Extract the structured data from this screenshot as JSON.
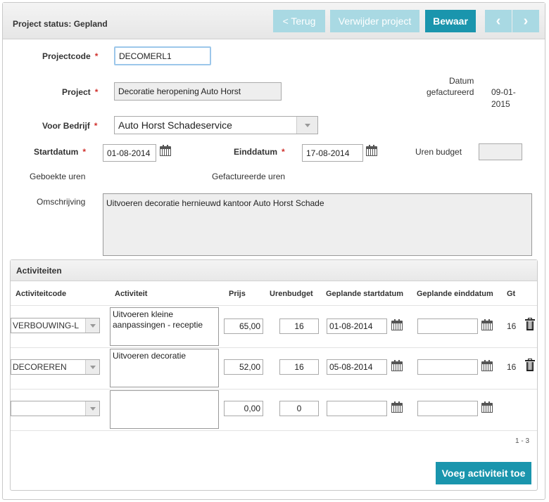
{
  "header": {
    "title": "Project status: Gepland",
    "back_label": "< Terug",
    "delete_label": "Verwijder project",
    "save_label": "Bewaar",
    "prev_label": "‹",
    "next_label": "›"
  },
  "form": {
    "projectcode_label": "Projectcode",
    "projectcode_value": "DECOMERL1",
    "project_label": "Project",
    "project_value": "Decoratie heropening Auto Horst",
    "datum_label_1": "Datum",
    "datum_label_2": "gefactureerd",
    "datum_value_1": "09-01-",
    "datum_value_2": "2015",
    "bedrijf_label": "Voor Bedrijf",
    "bedrijf_value": "Auto Horst Schadeservice",
    "startdatum_label": "Startdatum",
    "startdatum_value": "01-08-2014",
    "einddatum_label": "Einddatum",
    "einddatum_value": "17-08-2014",
    "uren_budget_label": "Uren budget",
    "uren_budget_value": "",
    "geboekte_uren_label": "Geboekte uren",
    "gefactureerde_uren_label": "Gefactureerde uren",
    "omschrijving_label": "Omschrijving",
    "omschrijving_value": "Uitvoeren decoratie hernieuwd kantoor Auto Horst Schade",
    "required_mark": "*"
  },
  "activities": {
    "title": "Activiteiten",
    "columns": [
      "Activiteitcode",
      "Activiteit",
      "Prijs",
      "Urenbudget",
      "Geplande startdatum",
      "Geplande einddatum",
      "Gt"
    ],
    "rows": [
      {
        "code": "VERBOUWING-L",
        "activity": "Uitvoeren kleine aanpassingen - receptie",
        "price": "65,00",
        "hours": "16",
        "start": "01-08-2014",
        "end": "",
        "gt": "16"
      },
      {
        "code": "DECOREREN",
        "activity": "Uitvoeren decoratie",
        "price": "52,00",
        "hours": "16",
        "start": "05-08-2014",
        "end": "",
        "gt": "16"
      },
      {
        "code": "",
        "activity": "",
        "price": "0,00",
        "hours": "0",
        "start": "",
        "end": "",
        "gt": ""
      }
    ],
    "pager": "1 - 3",
    "add_label": "Voeg activiteit toe"
  },
  "icons": [
    "calendar-icon",
    "trash-icon",
    "chevron-down-icon"
  ],
  "colors": {
    "accent": "#1a95ad",
    "accent_light": "#a9d9e3",
    "required": "#d0312d"
  }
}
